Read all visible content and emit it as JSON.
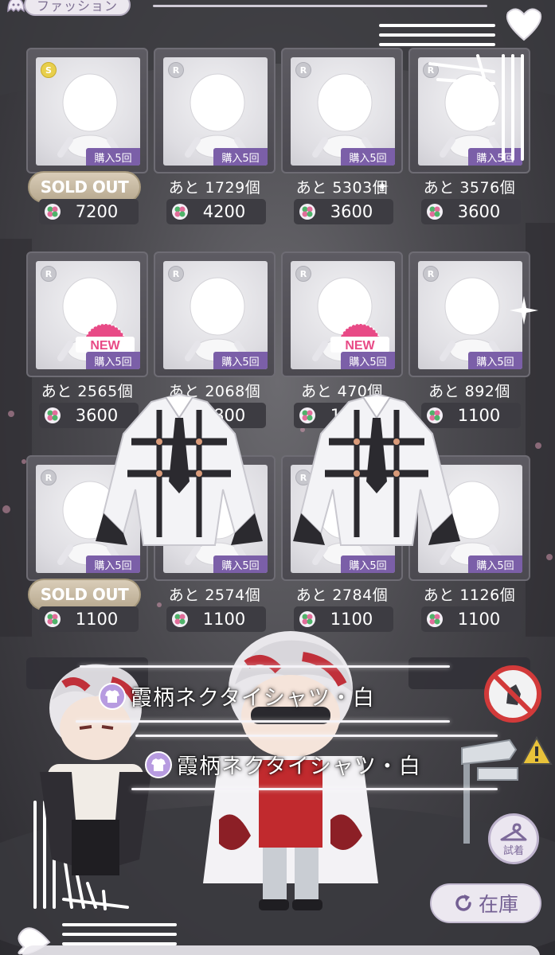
{
  "header": {
    "tab_label": "ファッション"
  },
  "items": [
    {
      "rarity": "S",
      "buy_badge": "購入5回",
      "status": "SOLD OUT",
      "price": "7200",
      "is_new": false
    },
    {
      "rarity": "R",
      "buy_badge": "購入5回",
      "status": "あと 1729個",
      "price": "4200",
      "is_new": false
    },
    {
      "rarity": "R",
      "buy_badge": "購入5回",
      "status": "あと 5303個",
      "price": "3600",
      "is_new": false
    },
    {
      "rarity": "R",
      "buy_badge": "購入5回",
      "status": "あと 3576個",
      "price": "3600",
      "is_new": false
    },
    {
      "rarity": "R",
      "buy_badge": "購入5回",
      "status": "あと 2565個",
      "price": "3600",
      "is_new": true
    },
    {
      "rarity": "R",
      "buy_badge": "購入5回",
      "status": "あと 2068個",
      "price": "1800",
      "is_new": false
    },
    {
      "rarity": "R",
      "buy_badge": "購入5回",
      "status": "あと 470個",
      "price": "1800",
      "is_new": true
    },
    {
      "rarity": "R",
      "buy_badge": "購入5回",
      "status": "あと 892個",
      "price": "1100",
      "is_new": false
    },
    {
      "rarity": "R",
      "buy_badge": "購入5回",
      "status": "SOLD OUT",
      "price": "1100",
      "is_new": false
    },
    {
      "rarity": "R",
      "buy_badge": "購入5回",
      "status": "あと 2574個",
      "price": "1100",
      "is_new": false
    },
    {
      "rarity": "R",
      "buy_badge": "購入5回",
      "status": "あと 2784個",
      "price": "1100",
      "is_new": false
    },
    {
      "rarity": "R",
      "buy_badge": "購入5回",
      "status": "あと 1126個",
      "price": "1100",
      "is_new": false
    }
  ],
  "new_label": "NEW",
  "overlay": {
    "item_name_1": "霞柄ネクタイシャツ・白",
    "item_name_2": "霞柄ネクタイシャツ・白"
  },
  "buttons": {
    "try_on_label": "試着",
    "stock_label": "在庫"
  },
  "colors": {
    "badge_purple": "#7b5fa8",
    "price_bg": "#3d3c42",
    "new_pink": "#e84a86",
    "soldout_gold": "#c6b89c",
    "clover_green": "#4fb36a",
    "clover_pink": "#e26d9a"
  }
}
